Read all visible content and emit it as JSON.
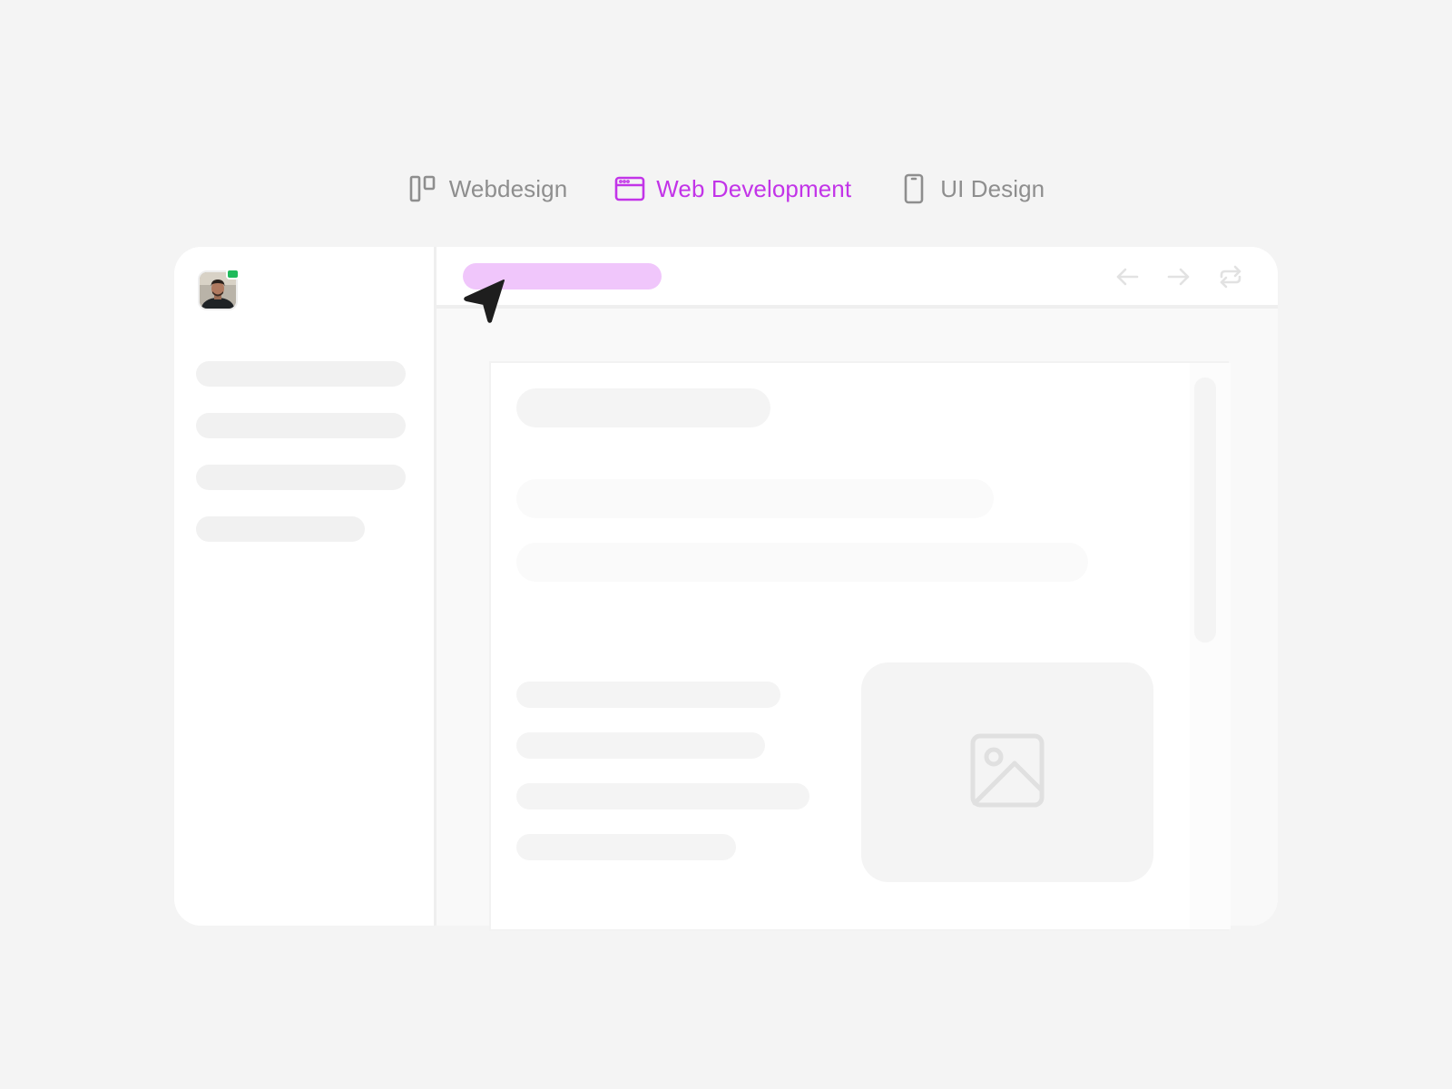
{
  "tabs": [
    {
      "label": "Webdesign",
      "icon": "columns-layout-icon",
      "active": false
    },
    {
      "label": "Web Development",
      "icon": "browser-window-icon",
      "active": true
    },
    {
      "label": "UI Design",
      "icon": "phone-icon",
      "active": false
    }
  ],
  "colors": {
    "active_tab": "#c234e8",
    "inactive_tab": "#8e8e8e",
    "url_bar": "#f0c6fb",
    "online_status": "#1fba5b",
    "page_background": "#f4f4f4",
    "skeleton": "#f4f4f4"
  },
  "icons": {
    "back": "arrow-left-icon",
    "forward": "arrow-right-icon",
    "refresh": "repeat-icon",
    "image_placeholder": "image-icon",
    "cursor": "navigation-pointer-icon"
  },
  "sidebar": {
    "avatar": "user-avatar",
    "status": "online"
  }
}
